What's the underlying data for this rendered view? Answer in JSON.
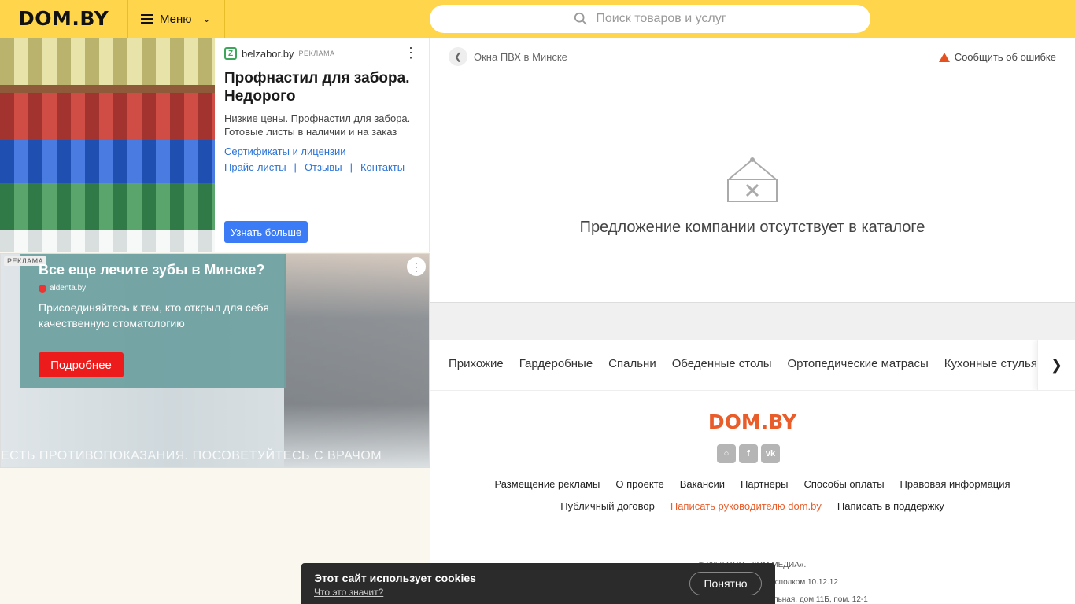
{
  "header": {
    "logo": "DOM.BY",
    "menu_label": "Меню",
    "search_placeholder": "Поиск товаров и услуг"
  },
  "ad1": {
    "source": "belzabor.by",
    "tag": "РЕКЛАМА",
    "title": "Профнастил для забора. Недорого",
    "text": "Низкие цены. Профнастил для забора. Готовые листы в наличии и на заказ",
    "link1": "Сертификаты и лицензии",
    "link2": "Прайс-листы",
    "link3": "Отзывы",
    "link4": "Контакты",
    "separator": "|",
    "button": "Узнать больше"
  },
  "ad2": {
    "tag": "РЕКЛАМА",
    "title": "Все еще лечите зубы в Минске?",
    "source": "aldenta.by",
    "text": "Присоединяйтесь к тем, кто открыл для себя качественную стоматологию",
    "button": "Подробнее",
    "disclaimer": "ЕСТЬ ПРОТИВОПОКАЗАНИЯ. ПОСОВЕТУЙТЕСЬ С ВРАЧОМ"
  },
  "main": {
    "breadcrumb": "Окна ПВХ в Минске",
    "report_label": "Сообщить об ошибке",
    "empty_message": "Предложение компании отсутствует в каталоге"
  },
  "categories": [
    "Прихожие",
    "Гардеробные",
    "Спальни",
    "Обеденные столы",
    "Ортопедические матрасы",
    "Кухонные стулья"
  ],
  "footer": {
    "logo": "DOM.BY",
    "links_row1": [
      "Размещение рекламы",
      "О проекте",
      "Вакансии",
      "Партнеры",
      "Способы оплаты",
      "Правовая информация"
    ],
    "links_row2": {
      "a": "Публичный договор",
      "b": "Написать руководителю dom.by",
      "c": "Написать в поддержку"
    },
    "fine1": "© 2022 ООО «ДОМ МЕДИА».",
    "fine2": "исполком 10.12.12",
    "fine3": "альная, дом 11Б, пом. 12-1"
  },
  "cookie": {
    "title": "Этот сайт использует cookies",
    "link": "Что это значит?",
    "button": "Понятно"
  },
  "colors": {
    "header_bg": "#ffd64b",
    "brand_orange": "#e95d2a",
    "link_blue": "#2b74d6",
    "ad_button_blue": "#3b7cf6",
    "ad_button_red": "#ed1c1c"
  }
}
